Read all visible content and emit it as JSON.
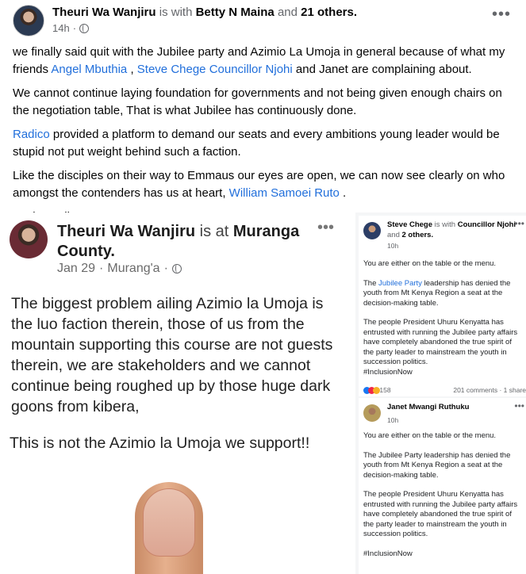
{
  "post": {
    "author": "Theuri Wa Wanjiru",
    "with_text": "is with",
    "tagged": "Betty N Maina",
    "and_text": "and",
    "others": "21 others.",
    "time": "14h",
    "dot": "·",
    "more": "•••",
    "para1_a": "we finally said quit with the Jubilee party and Azimio La Umoja in general because of what my friends ",
    "para1_link1": "Angel Mbuthia",
    "para1_comma": " , ",
    "para1_link2": "Steve Chege Councillor Njohi",
    "para1_b": " and Janet are complaining about.",
    "para2": "We cannot continue laying foundation for governments and not being given enough chairs on the negotiation table, That is what Jubilee has continuously done.",
    "para3_link": "Radico",
    "para3": " provided a platform to demand our seats and every ambitions young leader would be stupid not put weight behind such a faction.",
    "para4_a": "Like the disciples on their way to Emmaus our eyes are open, we can now see clearly on who amongst the contenders has us at heart, ",
    "para4_link": "William Samoei Ruto",
    "para4_b": " .",
    "hashtag": "#TukoRadico"
  },
  "left_card": {
    "author": "Theuri Wa Wanjiru",
    "is_at": "is at",
    "place": "Muranga County.",
    "date": "Jan 29",
    "dot1": "·",
    "location": "Murang'a",
    "dot2": "·",
    "more": "•••",
    "text": "The biggest problem ailing Azimio la Umoja is the luo faction therein, those of us from the mountain supporting this course are not guests therein, we are stakeholders and we cannot continue being roughed up by those huge dark goons from kibera,",
    "text2": "This is not the Azimio la Umoja we support!!"
  },
  "right_card_1": {
    "author": "Steve Chege",
    "is_with": "is with",
    "tagged": "Councillor Njohi",
    "and_text": "and",
    "others": "2 others.",
    "time": "10h",
    "more": "•••",
    "line1": "You are either on the table or the menu.",
    "line2_a": "The ",
    "line2_link": "Jubilee Party",
    "line2_b": " leadership has denied the",
    "line3": "youth from Mt Kenya Region a seat at the",
    "line4": "decision-making table.",
    "line5": "The people President Uhuru Kenyatta has",
    "line6": "entrusted with running the Jubilee party affairs",
    "line7": "have completely abandoned the true spirit of",
    "line8": "the party leader to mainstream the youth in",
    "line9": "succession politics.",
    "hashtag": "#InclusionNow",
    "reactions": "158",
    "comments": "201 comments · 1 share"
  },
  "right_card_2": {
    "author": "Janet Mwangi Ruthuku",
    "time": "10h",
    "more": "•••",
    "line1": "You are either on the table or the menu.",
    "line2": "The Jubilee Party leadership has denied the",
    "line3": "youth from Mt Kenya Region a seat at the",
    "line4": "decision-making table.",
    "line5": "The people President Uhuru Kenyatta has",
    "line6": "entrusted with running the Jubilee party affairs",
    "line7": "have completely abandoned the true spirit of",
    "line8": "the party leader to mainstream the youth in",
    "line9": "succession politics.",
    "hashtag": "#InclusionNow"
  },
  "colors": {
    "link": "#216fdb",
    "meta": "#65676b",
    "text": "#050505"
  },
  "icons": [
    "globe-icon",
    "more-icon",
    "finger-image"
  ]
}
